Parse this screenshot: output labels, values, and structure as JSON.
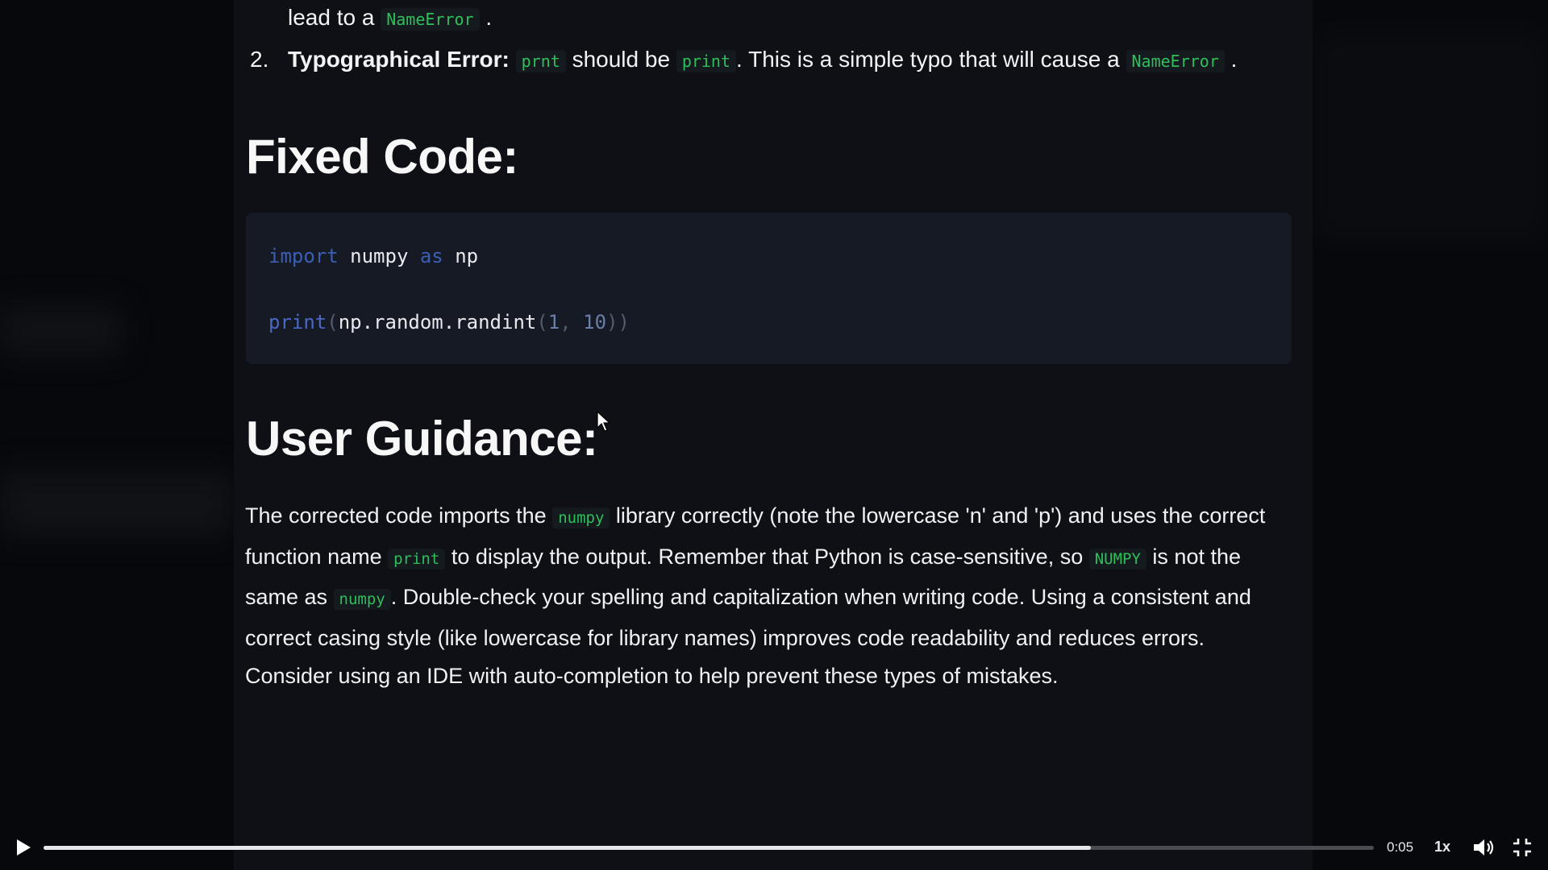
{
  "list": {
    "item1": {
      "prefix": "lead to a",
      "code": "NameError",
      "suffix": "."
    },
    "item2": {
      "number": "2.",
      "title": "Typographical Error:",
      "code1": "prnt",
      "mid1": "should be",
      "code2": "print",
      "mid2": ". This is a simple typo that will cause a",
      "code3": "NameError",
      "suffix": "."
    }
  },
  "fixed_code": {
    "heading": "Fixed Code:",
    "line1": {
      "kw_import": "import",
      "module": " numpy ",
      "kw_as": "as",
      "alias": " np"
    },
    "line2": {
      "fn": "print",
      "open": "(",
      "call": "np.random.randint",
      "open2": "(",
      "arg1": "1",
      "comma": ", ",
      "arg2": "10",
      "close": "))"
    }
  },
  "guidance": {
    "heading": "User Guidance:",
    "t1": "The corrected code imports the ",
    "c1": "numpy",
    "t2": " library correctly (note the lowercase 'n' and 'p') and uses the correct function name ",
    "c2": "print",
    "t3": " to display the output. Remember that Python is case-sensitive, so ",
    "c3": "NUMPY",
    "t4": " is not the same as ",
    "c4": "numpy",
    "t5": ". Double-check your spelling and capitalization when writing code. Using a consistent and correct casing style (like lowercase for library names) improves code readability and reduces errors. Consider using an IDE with auto-completion to help prevent these types of mistakes."
  },
  "player": {
    "time": "0:05",
    "speed": "1x",
    "progress": 0.787,
    "icons": {
      "play": "play-icon",
      "volume": "volume-icon",
      "fullscreen": "fullscreen-icon",
      "cursor": "mouse-cursor-icon"
    }
  },
  "colors": {
    "inline_code": "#2fbf5a",
    "panel_bg": "#0e1016",
    "code_block_bg": "#161a24",
    "keyword": "#3a5fb4"
  }
}
